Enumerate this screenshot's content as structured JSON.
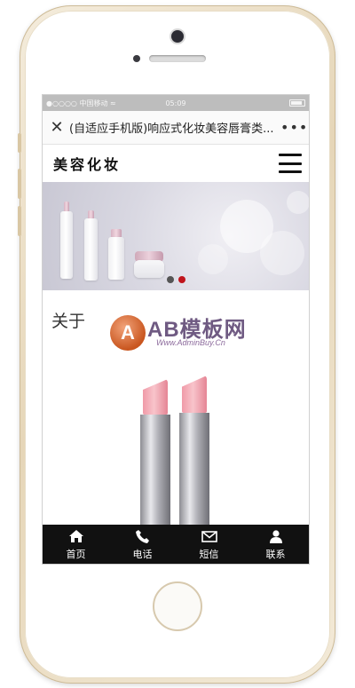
{
  "status_bar": {
    "carrier": "●○○○○ 中国移动 ≈",
    "time": "05:09"
  },
  "title_bar": {
    "title": "(自适应手机版)响应式化妆美容唇膏类...",
    "close_icon": "close-icon",
    "more_icon": "more-icon"
  },
  "site_header": {
    "logo_text": "美容化妆",
    "menu_icon": "hamburger-menu-icon"
  },
  "banner": {
    "slide_count": 2,
    "active_slide": 2
  },
  "about": {
    "title": "关于"
  },
  "watermark": {
    "badge": "A",
    "brand": "AB模板网",
    "url": "Www.AdminBuy.Cn"
  },
  "tab_bar": {
    "items": [
      {
        "label": "首页",
        "icon": "home-icon"
      },
      {
        "label": "电话",
        "icon": "phone-icon"
      },
      {
        "label": "短信",
        "icon": "envelope-icon"
      },
      {
        "label": "联系",
        "icon": "user-icon"
      }
    ]
  },
  "colors": {
    "tab_bar_bg": "#111111",
    "active_dot": "#c0141c",
    "phone_gold": "#e6d6b8"
  }
}
